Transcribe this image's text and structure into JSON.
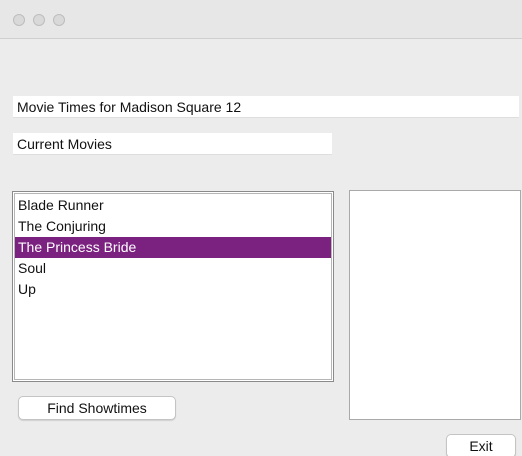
{
  "window": {
    "controls": [
      "close-icon",
      "minimize-icon",
      "zoom-icon"
    ]
  },
  "theater_label": "Movie Times for Madison Square 12",
  "movies_label": "Current Movies",
  "movies": {
    "items": [
      "Blade Runner",
      "The Conjuring",
      "The Princess Bride",
      "Soul",
      "Up"
    ],
    "selected_index": 2,
    "selection_color": "#7b2180"
  },
  "showtimes": {
    "items": []
  },
  "buttons": {
    "find_showtimes": "Find Showtimes",
    "exit": "Exit"
  }
}
